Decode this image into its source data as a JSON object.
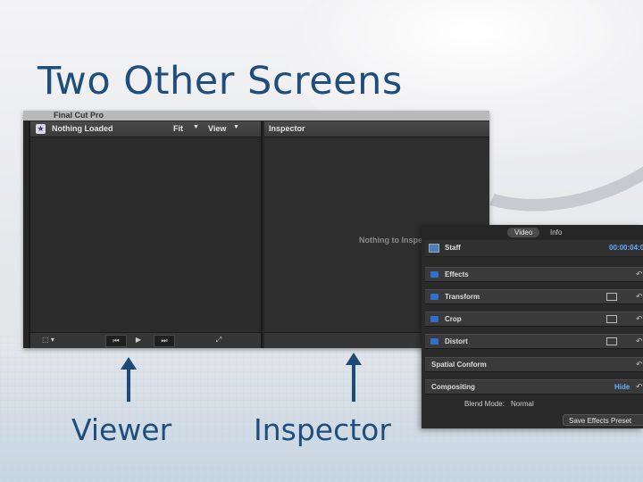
{
  "slide": {
    "title": "Two Other Screens",
    "caption_viewer": "Viewer",
    "caption_inspector": "Inspector"
  },
  "fcp_window": {
    "app_title": "Final Cut Pro",
    "viewer": {
      "status": "Nothing Loaded",
      "fit_menu": "Fit",
      "view_menu": "View"
    },
    "inspector": {
      "title": "Inspector",
      "empty_message": "Nothing to Inspect"
    }
  },
  "inspector_panel": {
    "tabs": [
      "Video",
      "Info"
    ],
    "active_tab": "Video",
    "clip_name": "Staff",
    "clip_timecode": "00:00:04:0",
    "sections": [
      {
        "label": "Effects"
      },
      {
        "label": "Transform"
      },
      {
        "label": "Crop"
      },
      {
        "label": "Distort"
      },
      {
        "label": "Spatial Conform"
      },
      {
        "label": "Compositing",
        "toggle": "Hide"
      }
    ],
    "blend_mode_label": "Blend Mode:",
    "blend_mode_value": "Normal",
    "save_button": "Save Effects Preset"
  },
  "colors": {
    "title_blue": "#1e4f7c",
    "accent_blue": "#6aa9ff",
    "checkbox_blue": "#2f6fd0"
  }
}
